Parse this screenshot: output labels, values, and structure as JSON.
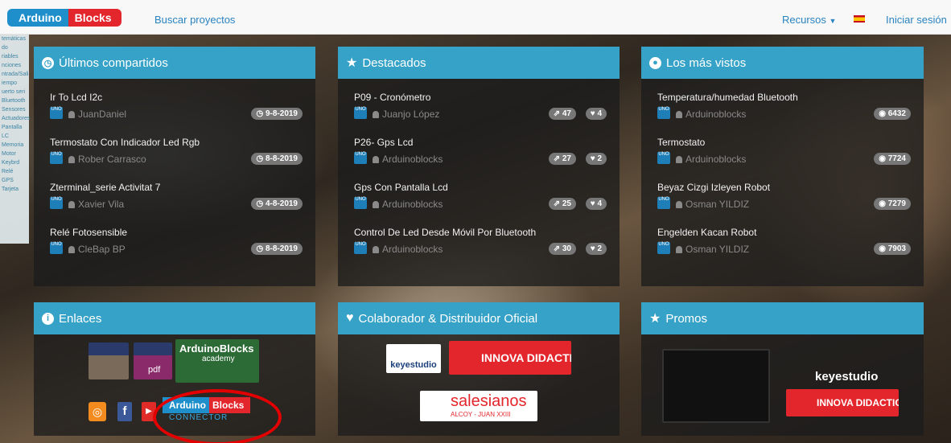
{
  "nav": {
    "logo_left": "Arduino",
    "logo_right": "Blocks",
    "search_projects": "Buscar proyectos",
    "resources": "Recursos",
    "login": "Iniciar sesión"
  },
  "side_strip": [
    "temáticas",
    "do",
    "riables",
    "nciones",
    "ntrada/Sali",
    "iempo",
    "uerto seri",
    "Bluetooth",
    "Sensores",
    "Actuadores",
    "Pantalla LC",
    "Memoria",
    "Motor",
    "Keybrd",
    "Relé",
    "GPS",
    "Tarjeta"
  ],
  "latest": {
    "heading": "Últimos compartidos",
    "items": [
      {
        "title": "Ir To Lcd I2c",
        "user": "JuanDaniel",
        "date": "9-8-2019"
      },
      {
        "title": "Termostato Con Indicador Led Rgb",
        "user": "Rober Carrasco",
        "date": "8-8-2019"
      },
      {
        "title": "Zterminal_serie Activitat 7",
        "user": "Xavier Vila",
        "date": "4-8-2019"
      },
      {
        "title": "Relé Fotosensible",
        "user": "CleBap BP",
        "date": "8-8-2019"
      }
    ]
  },
  "featured": {
    "heading": "Destacados",
    "items": [
      {
        "title": "P09 - Cronómetro",
        "user": "Juanjo López",
        "shares": "47",
        "likes": "4"
      },
      {
        "title": "P26- Gps Lcd",
        "user": "Arduinoblocks",
        "shares": "27",
        "likes": "2"
      },
      {
        "title": "Gps Con Pantalla Lcd",
        "user": "Arduinoblocks",
        "shares": "25",
        "likes": "4"
      },
      {
        "title": "Control De Led Desde Móvil Por Bluetooth",
        "user": "Arduinoblocks",
        "shares": "30",
        "likes": "2"
      }
    ]
  },
  "most_viewed": {
    "heading": "Los más vistos",
    "items": [
      {
        "title": "Temperatura/humedad Bluetooth",
        "user": "Arduinoblocks",
        "views": "6432"
      },
      {
        "title": "Termostato",
        "user": "Arduinoblocks",
        "views": "7724"
      },
      {
        "title": "Beyaz Cizgi Izleyen Robot",
        "user": "Osman YILDIZ",
        "views": "7279"
      },
      {
        "title": "Engelden Kacan Robot",
        "user": "Osman YILDIZ",
        "views": "7903"
      }
    ]
  },
  "links": {
    "heading": "Enlaces",
    "academy": "ArduinoBlocks",
    "academy_sub": "academy",
    "pdf": "pdf",
    "connector_left": "Arduino",
    "connector_right": "Blocks",
    "connector_sub": "CONNECTOR"
  },
  "partners": {
    "heading": "Colaborador & Distribuidor Oficial",
    "keyestudio": "keyestudio",
    "innova": "INNOVA DIDACTIC",
    "salesianos": "salesianos",
    "salesianos_sub": "ALCOY - JUAN XXIII"
  },
  "promos": {
    "heading": "Promos",
    "keyestudio": "keyestudio",
    "innova": "INNOVA DIDACTIC"
  },
  "colors": {
    "accent": "#36a2c7",
    "link": "#2a83c1",
    "logo_blue": "#1f8fcc",
    "logo_red": "#e3262b",
    "annotation": "#e30000"
  }
}
